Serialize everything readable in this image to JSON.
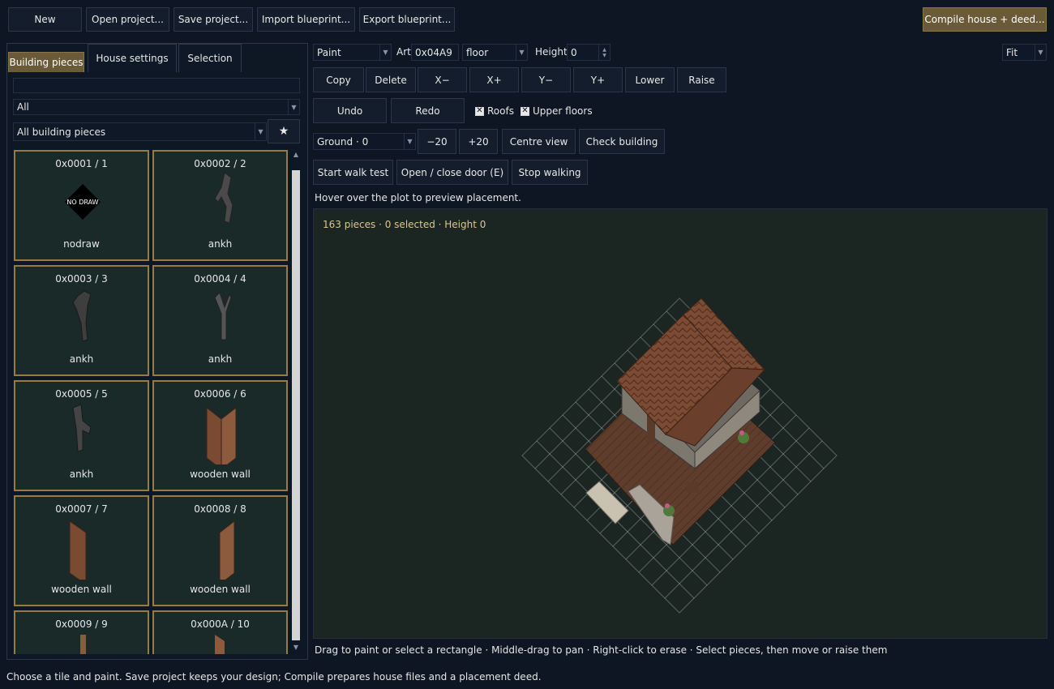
{
  "toolbar": {
    "new_label": "New",
    "open_label": "Open project...",
    "save_label": "Save project...",
    "import_label": "Import blueprint...",
    "export_label": "Export blueprint...",
    "compile_label": "Compile house + deed..."
  },
  "tabs": {
    "building_pieces": "Building pieces",
    "house_settings": "House settings",
    "selection": "Selection"
  },
  "palette": {
    "search_value": "",
    "category_value": "All",
    "set_value": "All building pieces",
    "favorite_glyph": "★",
    "tiles": [
      {
        "code": "0x0001 / 1",
        "name": "nodraw",
        "icon_label": "NO DRAW"
      },
      {
        "code": "0x0002 / 2",
        "name": "ankh"
      },
      {
        "code": "0x0003 / 3",
        "name": "ankh"
      },
      {
        "code": "0x0004 / 4",
        "name": "ankh"
      },
      {
        "code": "0x0005 / 5",
        "name": "ankh"
      },
      {
        "code": "0x0006 / 6",
        "name": "wooden wall"
      },
      {
        "code": "0x0007 / 7",
        "name": "wooden wall"
      },
      {
        "code": "0x0008 / 8",
        "name": "wooden wall"
      },
      {
        "code": "0x0009 / 9",
        "name": ""
      },
      {
        "code": "0x000A / 10",
        "name": ""
      }
    ]
  },
  "tools": {
    "mode_value": "Paint",
    "art_label": "Art",
    "art_value": "0x04A9",
    "layer_value": "floor",
    "height_label": "Height",
    "height_value": "0",
    "zoom_value": "Fit",
    "copy": "Copy",
    "delete": "Delete",
    "x_minus": "X−",
    "x_plus": "X+",
    "y_minus": "Y−",
    "y_plus": "Y+",
    "lower": "Lower",
    "raise": "Raise",
    "undo": "Undo",
    "redo": "Redo",
    "roofs_label": "Roofs",
    "upper_floors_label": "Upper floors",
    "check_mark": "✕",
    "floor_value": "Ground · 0",
    "minus20": "−20",
    "plus20": "+20",
    "centre_view": "Centre view",
    "check_building": "Check building",
    "start_walk": "Start walk test",
    "open_close_door": "Open / close door (E)",
    "stop_walking": "Stop walking",
    "hover_hint": "Hover over the plot to preview placement."
  },
  "viewport": {
    "stats": "163 pieces · 0 selected · Height 0",
    "help": "Drag to paint or select a rectangle · Middle-drag to pan · Right-click to erase · Select pieces, then move or raise them"
  },
  "status": {
    "text": "Choose a tile and paint. Save project keeps your design; Compile prepares house files and a placement deed."
  },
  "colors": {
    "accent": "#6b5a38",
    "tile_border": "#9a7b3f",
    "background": "#0d1622",
    "stats_text": "#d8c88a"
  }
}
